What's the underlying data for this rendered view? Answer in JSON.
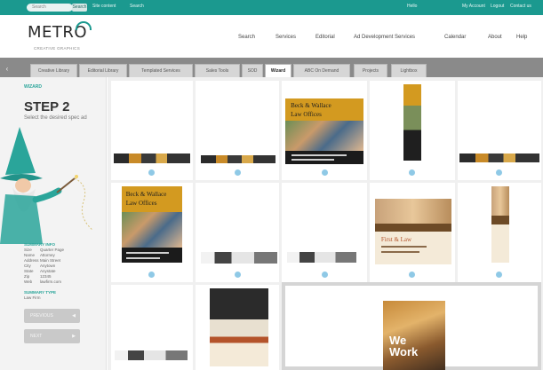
{
  "topbar": {
    "search_placeholder": "Search",
    "search_button": "Search",
    "links": [
      "Site content",
      "Search"
    ],
    "right_links": [
      "Hello",
      "My Account",
      "Logout",
      "Contact us"
    ]
  },
  "header": {
    "logo": "METRO",
    "tagline": "CREATIVE GRAPHICS",
    "nav": [
      "Search",
      "Services",
      "Editorial",
      "Ad Development Services",
      "Calendar",
      "About",
      "Help"
    ]
  },
  "tabs": [
    "Creative Library",
    "Editorial Library",
    "Templated Services",
    "Sales Tools",
    "SOD",
    "Wizard",
    "ABC On Demand",
    "Projects",
    "Lightbox"
  ],
  "active_tab": "Wizard",
  "wizard": {
    "heading": "WIZARD",
    "step_title": "STEP 2",
    "step_subtitle": "Select the desired spec ad",
    "summary_heading": "SUMMARY INFO",
    "summary": [
      {
        "label": "Size",
        "value": "Quarter Page"
      },
      {
        "label": "Name",
        "value": "Attorney"
      },
      {
        "label": "Address",
        "value": "Main Street"
      },
      {
        "label": "City",
        "value": "Anytown"
      },
      {
        "label": "State",
        "value": "Anystate"
      },
      {
        "label": "Zip",
        "value": "12345"
      },
      {
        "label": "Web",
        "value": "lawfirm.com"
      }
    ],
    "summary_type_heading": "SUMMARY TYPE",
    "summary_type_value": "Law Firm",
    "prev_button": "PREVIOUS",
    "next_button": "NEXT"
  },
  "ads": {
    "law_line1": "Beck & Wallace",
    "law_line2": "Law Offices",
    "work_line": "First & Law",
    "big_line1": "We",
    "big_line2": "Work"
  },
  "colors": {
    "accent": "#1b998f",
    "ad_gold": "#d39a20",
    "select_dot": "#8fc9e6"
  }
}
